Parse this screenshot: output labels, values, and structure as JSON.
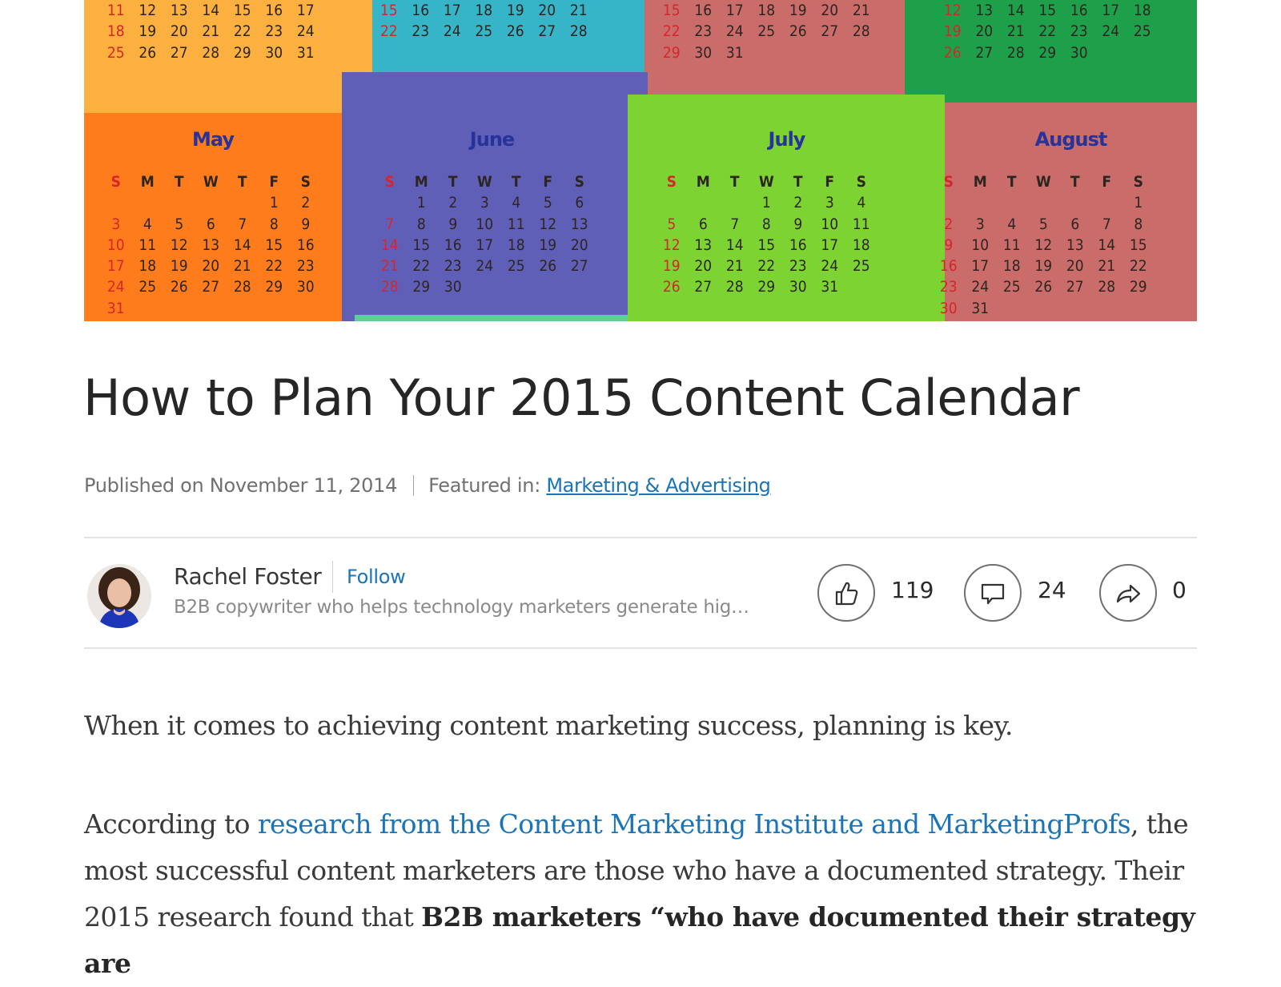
{
  "hero": {
    "colors": {
      "apr_panel": "#fbb040",
      "may_panel": "#ff7c1d",
      "jun_panel": "#605fb8",
      "jun_top_panel": "#36b4c8",
      "jul_panel": "#7dd332",
      "aug_panel": "#c96c6a",
      "aug_top_panel": "#c96c6a",
      "green_panel": "#1ea04a",
      "strip": "#5fcf9a"
    },
    "weekday_labels": [
      "S",
      "M",
      "T",
      "W",
      "T",
      "F",
      "S"
    ],
    "months": [
      {
        "key": "partial-1",
        "name": "",
        "rows": [
          [
            "11",
            "12",
            "13",
            "14",
            "15",
            "16",
            "17"
          ],
          [
            "18",
            "19",
            "20",
            "21",
            "22",
            "23",
            "24"
          ],
          [
            "25",
            "26",
            "27",
            "28",
            "29",
            "30",
            "31"
          ]
        ]
      },
      {
        "key": "partial-2",
        "name": "",
        "rows": [
          [
            "15",
            "16",
            "17",
            "18",
            "19",
            "20",
            "21"
          ],
          [
            "22",
            "23",
            "24",
            "25",
            "26",
            "27",
            "28"
          ]
        ]
      },
      {
        "key": "partial-3",
        "name": "",
        "rows": [
          [
            "15",
            "16",
            "17",
            "18",
            "19",
            "20",
            "21"
          ],
          [
            "22",
            "23",
            "24",
            "25",
            "26",
            "27",
            "28"
          ],
          [
            "29",
            "30",
            "31",
            "",
            "",
            "",
            ""
          ]
        ]
      },
      {
        "key": "partial-4",
        "name": "",
        "rows": [
          [
            "12",
            "13",
            "14",
            "15",
            "16",
            "17",
            "18"
          ],
          [
            "19",
            "20",
            "21",
            "22",
            "23",
            "24",
            "25"
          ],
          [
            "26",
            "27",
            "28",
            "29",
            "30",
            "",
            ""
          ]
        ]
      },
      {
        "key": "may",
        "name": "May",
        "rows": [
          [
            "",
            "",
            "",
            "",
            "",
            "1",
            "2"
          ],
          [
            "3",
            "4",
            "5",
            "6",
            "7",
            "8",
            "9"
          ],
          [
            "10",
            "11",
            "12",
            "13",
            "14",
            "15",
            "16"
          ],
          [
            "17",
            "18",
            "19",
            "20",
            "21",
            "22",
            "23"
          ],
          [
            "24",
            "25",
            "26",
            "27",
            "28",
            "29",
            "30"
          ],
          [
            "31",
            "",
            "",
            "",
            "",
            "",
            ""
          ]
        ]
      },
      {
        "key": "june",
        "name": "June",
        "rows": [
          [
            "",
            "1",
            "2",
            "3",
            "4",
            "5",
            "6"
          ],
          [
            "7",
            "8",
            "9",
            "10",
            "11",
            "12",
            "13"
          ],
          [
            "14",
            "15",
            "16",
            "17",
            "18",
            "19",
            "20"
          ],
          [
            "21",
            "22",
            "23",
            "24",
            "25",
            "26",
            "27"
          ],
          [
            "28",
            "29",
            "30",
            "",
            "",
            "",
            ""
          ]
        ]
      },
      {
        "key": "july",
        "name": "July",
        "rows": [
          [
            "",
            "",
            "",
            "1",
            "2",
            "3",
            "4"
          ],
          [
            "5",
            "6",
            "7",
            "8",
            "9",
            "10",
            "11"
          ],
          [
            "12",
            "13",
            "14",
            "15",
            "16",
            "17",
            "18"
          ],
          [
            "19",
            "20",
            "21",
            "22",
            "23",
            "24",
            "25"
          ],
          [
            "26",
            "27",
            "28",
            "29",
            "30",
            "31",
            ""
          ]
        ]
      },
      {
        "key": "august",
        "name": "August",
        "rows": [
          [
            "",
            "",
            "",
            "",
            "",
            "",
            "1"
          ],
          [
            "2",
            "3",
            "4",
            "5",
            "6",
            "7",
            "8"
          ],
          [
            "9",
            "10",
            "11",
            "12",
            "13",
            "14",
            "15"
          ],
          [
            "16",
            "17",
            "18",
            "19",
            "20",
            "21",
            "22"
          ],
          [
            "23",
            "24",
            "25",
            "26",
            "27",
            "28",
            "29"
          ],
          [
            "30",
            "31",
            "",
            "",
            "",
            "",
            ""
          ]
        ]
      }
    ]
  },
  "article": {
    "title": "How to Plan Your 2015 Content Calendar",
    "published": "Published on November 11, 2014",
    "featured_label": "Featured in:",
    "featured_category": "Marketing & Advertising"
  },
  "author": {
    "name": "Rachel Foster",
    "follow_label": "Follow",
    "headline": "B2B copywriter who helps technology marketers generate hig…"
  },
  "actions": {
    "like": {
      "icon": "thumbs-up-icon",
      "count": "119"
    },
    "comment": {
      "icon": "comment-icon",
      "count": "24"
    },
    "share": {
      "icon": "share-arrow-icon",
      "count": "0"
    }
  },
  "body": {
    "para1": "When it comes to achieving content marketing success, planning is key.",
    "para2_start": "According to ",
    "para2_link": "research from the Content Marketing Institute and MarketingProfs",
    "para2_mid": ", the most successful content marketers are those who have a documented strategy. Their 2015 research found that ",
    "para2_bold": "B2B marketers “who have documented their strategy are"
  },
  "colors": {
    "link": "#1a74b7",
    "text": "#262626",
    "muted": "#707070",
    "sunday": "#d6262b",
    "month_name": "#27329a"
  }
}
